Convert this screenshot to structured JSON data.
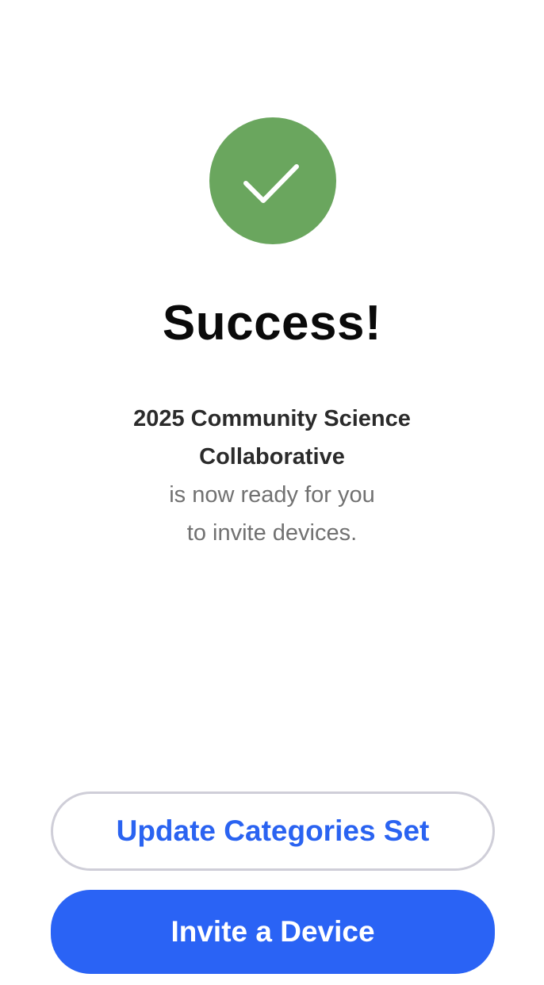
{
  "success": {
    "icon": "checkmark-icon",
    "badge_color": "#6aa65e",
    "title": "Success!"
  },
  "message": {
    "project_name_line1": "2025 Community Science",
    "project_name_line2": "Collaborative",
    "line1": "is now ready for you",
    "line2": "to invite devices."
  },
  "actions": {
    "secondary_label": "Update Categories Set",
    "primary_label": "Invite a Device",
    "accent_color": "#2a63f5"
  }
}
